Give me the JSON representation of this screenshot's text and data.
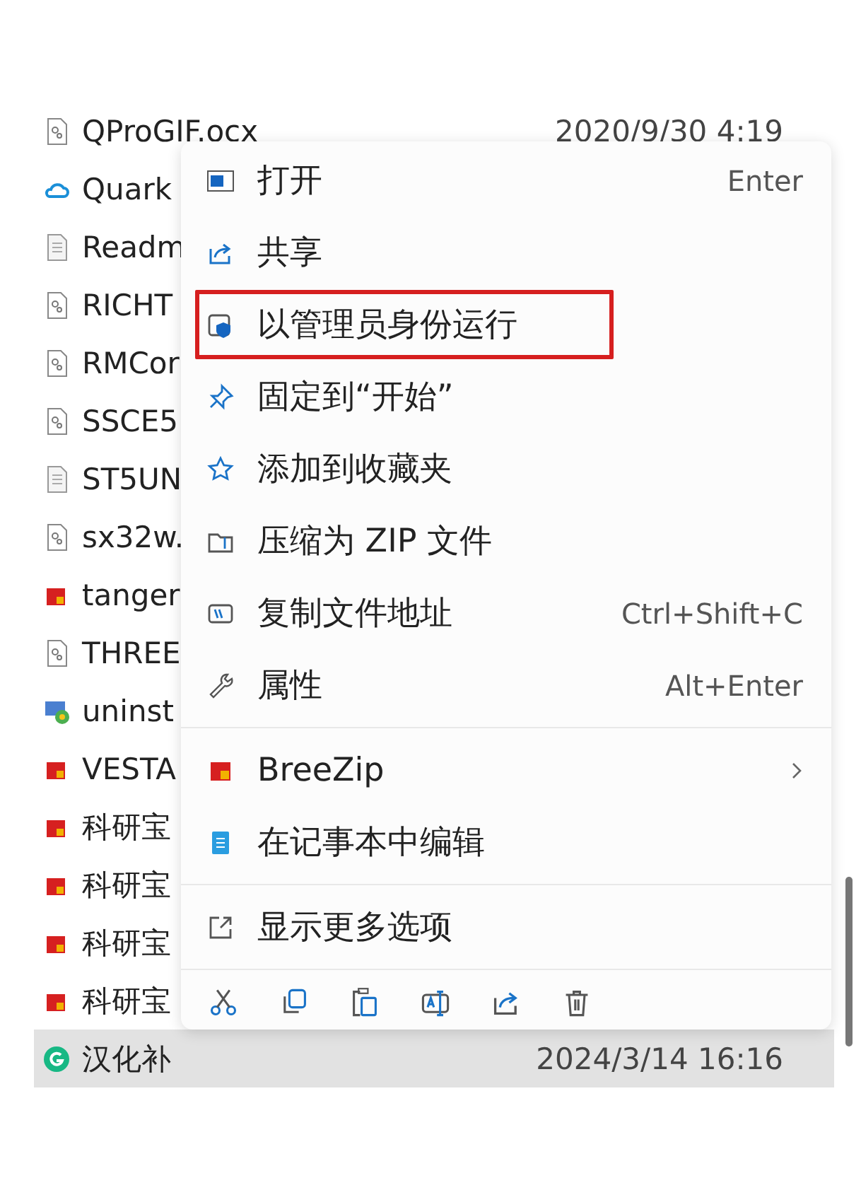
{
  "files": [
    {
      "name": "QProGIF.ocx",
      "kind": "component",
      "date": "2020/9/30 4:19",
      "selected": false
    },
    {
      "name": "Quark",
      "kind": "cloud",
      "selected": false
    },
    {
      "name": "Readm",
      "kind": "text",
      "selected": false
    },
    {
      "name": "RICHT",
      "kind": "component",
      "selected": false
    },
    {
      "name": "RMCor",
      "kind": "component",
      "selected": false
    },
    {
      "name": "SSCE5",
      "kind": "component",
      "selected": false
    },
    {
      "name": "ST5UN",
      "kind": "text",
      "selected": false
    },
    {
      "name": "sx32w.",
      "kind": "component",
      "selected": false
    },
    {
      "name": "tanger",
      "kind": "archive",
      "selected": false
    },
    {
      "name": "THREE",
      "kind": "component",
      "selected": false
    },
    {
      "name": "uninst",
      "kind": "installer",
      "selected": false
    },
    {
      "name": "VESTA",
      "kind": "archive",
      "selected": false
    },
    {
      "name": "科研宝",
      "kind": "archive",
      "selected": false
    },
    {
      "name": "科研宝",
      "kind": "archive",
      "selected": false
    },
    {
      "name": "科研宝",
      "kind": "archive",
      "selected": false
    },
    {
      "name": "科研宝",
      "kind": "archive",
      "selected": false
    },
    {
      "name": "汉化补",
      "kind": "app",
      "date": "2024/3/14 16:16",
      "selected": true
    }
  ],
  "menu": {
    "groups": [
      [
        {
          "label": "打开",
          "kind": "open",
          "shortcut": "Enter",
          "highlighted": false
        },
        {
          "label": "共享",
          "kind": "share",
          "highlighted": false
        },
        {
          "label": "以管理员身份运行",
          "kind": "shield",
          "highlighted": true
        },
        {
          "label": "固定到“开始”",
          "kind": "pin",
          "highlighted": false
        },
        {
          "label": "添加到收藏夹",
          "kind": "star",
          "highlighted": false
        },
        {
          "label": "压缩为 ZIP 文件",
          "kind": "zip",
          "highlighted": false
        },
        {
          "label": "复制文件地址",
          "kind": "path",
          "shortcut": "Ctrl+Shift+C",
          "highlighted": false
        },
        {
          "label": "属性",
          "kind": "wrench",
          "shortcut": "Alt+Enter",
          "highlighted": false
        }
      ],
      [
        {
          "label": "BreeZip",
          "kind": "archive",
          "submenu": true,
          "highlighted": false
        },
        {
          "label": "在记事本中编辑",
          "kind": "notepad",
          "highlighted": false
        }
      ],
      [
        {
          "label": "显示更多选项",
          "kind": "more",
          "highlighted": false
        }
      ]
    ],
    "toolbar": [
      {
        "kind": "cut"
      },
      {
        "kind": "copy"
      },
      {
        "kind": "paste"
      },
      {
        "kind": "rename"
      },
      {
        "kind": "share"
      },
      {
        "kind": "delete"
      }
    ]
  }
}
